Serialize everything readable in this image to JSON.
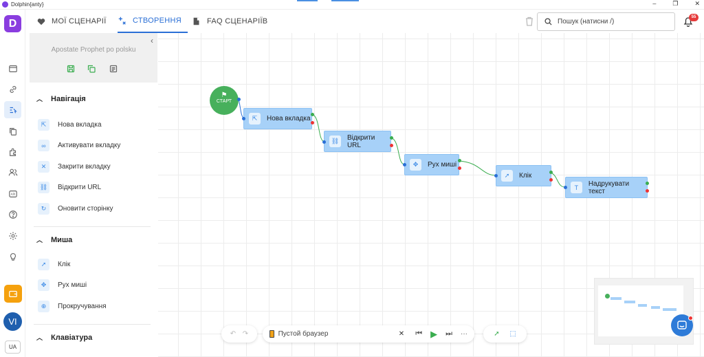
{
  "window": {
    "title": "Dolphin{anty}",
    "controls": [
      "–",
      "❐",
      "✕"
    ]
  },
  "leftbar": {
    "logo": "D",
    "avatar": "VI",
    "language": "UA"
  },
  "tabs": [
    {
      "label": "МОЇ СЦЕНАРІЇ",
      "icon": "heart-icon"
    },
    {
      "label": "СТВОРЕННЯ",
      "icon": "sparkle-icon",
      "active": true
    },
    {
      "label": "FAQ СЦЕНАРІЇВ",
      "icon": "book-icon"
    }
  ],
  "search": {
    "placeholder": "Пошук (натисни /)"
  },
  "notifications": {
    "count": "55"
  },
  "script": {
    "name": "Apostate Prophet po polsku"
  },
  "sections": [
    {
      "title": "Навігація",
      "items": [
        "Нова вкладка",
        "Активувати вкладку",
        "Закрити вкладку",
        "Відкрити URL",
        "Оновити сторінку"
      ]
    },
    {
      "title": "Миша",
      "items": [
        "Клік",
        "Рух миші",
        "Прокручування"
      ]
    },
    {
      "title": "Клавіатура",
      "items": []
    }
  ],
  "flow": {
    "start_label": "СТАРТ",
    "nodes": [
      "Нова вкладка",
      "Відкрити URL",
      "Рух миші",
      "Клік",
      "Надрукувати текст"
    ]
  },
  "bottombar": {
    "browser": "Пустой браузер",
    "more": "···"
  },
  "colors": {
    "accent": "#2a6fd6",
    "brand": "#8a3ddf",
    "start": "#47b05c",
    "node": "#a7d1f8"
  }
}
